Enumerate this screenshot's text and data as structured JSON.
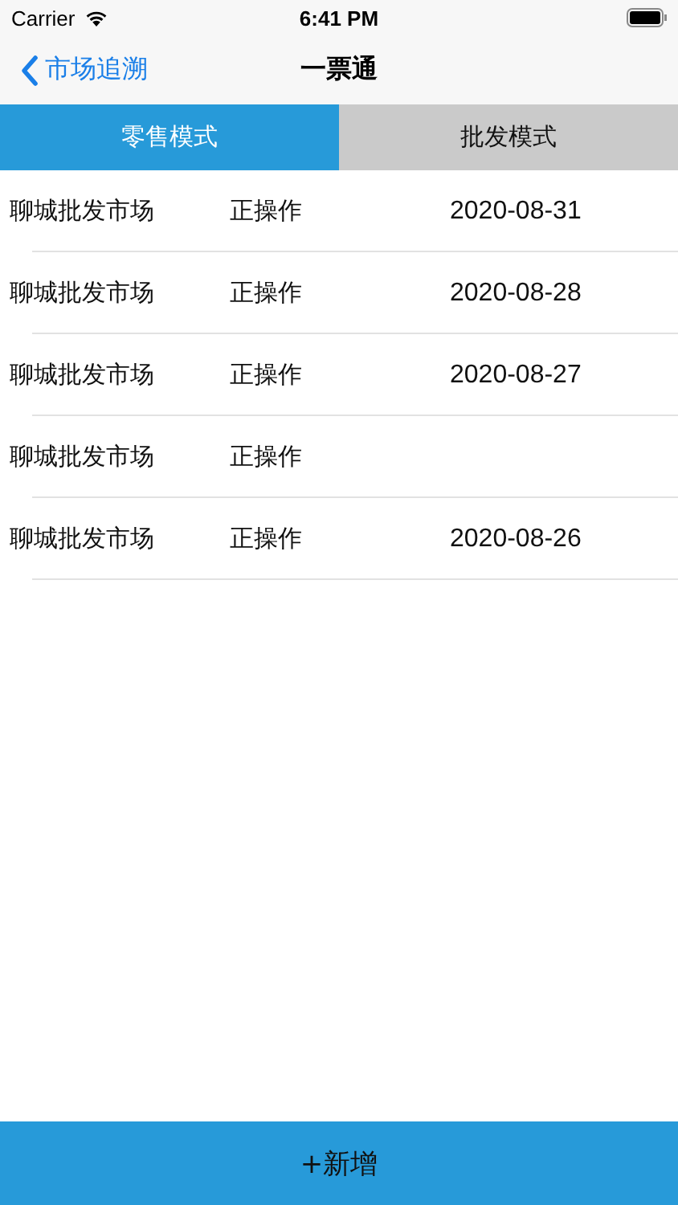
{
  "status_bar": {
    "carrier": "Carrier",
    "time": "6:41 PM"
  },
  "nav": {
    "back": "市场追溯",
    "title": "一票通"
  },
  "tabs": [
    {
      "label": "零售模式",
      "selected": true
    },
    {
      "label": "批发模式",
      "selected": false
    }
  ],
  "rows": [
    {
      "market": "聊城批发市场",
      "status": "正操作",
      "date": "2020-08-31"
    },
    {
      "market": "聊城批发市场",
      "status": "正操作",
      "date": "2020-08-28"
    },
    {
      "market": "聊城批发市场",
      "status": "正操作",
      "date": "2020-08-27"
    },
    {
      "market": "聊城批发市场",
      "status": "正操作"
    },
    {
      "market": "聊城批发市场",
      "status": "正操作",
      "date": "2020-08-26"
    }
  ],
  "add_button": "+新增"
}
